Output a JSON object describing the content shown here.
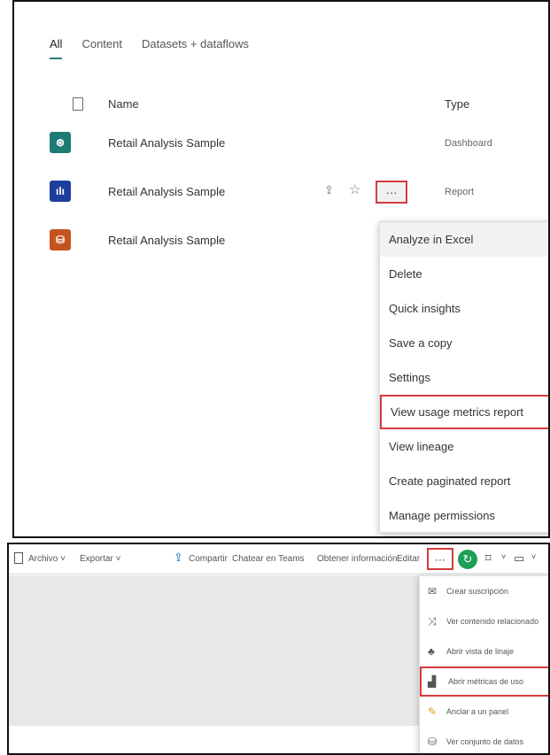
{
  "workspace": {
    "tabs": [
      {
        "label": "All",
        "active": true
      },
      {
        "label": "Content",
        "active": false
      },
      {
        "label": "Datasets + dataflows",
        "active": false
      }
    ],
    "columns": {
      "name": "Name",
      "type": "Type"
    },
    "items": [
      {
        "name": "Retail Analysis Sample",
        "type": "Dashboard",
        "icon": "dashboard-icon",
        "icon_glyph": "⊛",
        "color": "#1e7a74"
      },
      {
        "name": "Retail Analysis Sample",
        "type": "Report",
        "icon": "report-icon",
        "icon_glyph": "ılı",
        "color": "#1d3e9c"
      },
      {
        "name": "Retail Analysis Sample",
        "type": "",
        "icon": "dataset-icon",
        "icon_glyph": "⛁",
        "color": "#c6531f"
      }
    ],
    "more_label": "···",
    "context_menu": [
      "Analyze in Excel",
      "Delete",
      "Quick insights",
      "Save a copy",
      "Settings",
      "View usage metrics report",
      "View lineage",
      "Create paginated report",
      "Manage permissions"
    ]
  },
  "report_toolbar": {
    "file": "Archivo ˅",
    "export": "Exportar ˅",
    "share": "Compartir",
    "teams": "Chatear en Teams",
    "insights": "Obtener información",
    "edit": "Editar",
    "more": "···",
    "refresh_icon": "refresh-icon",
    "bookmark_icon": "bookmark-icon",
    "view_icon": "view-icon"
  },
  "report_menu": [
    {
      "label": "Crear suscripción",
      "icon": "subscribe-icon",
      "glyph": "✉"
    },
    {
      "label": "Ver contenido relacionado",
      "icon": "related-content-icon",
      "glyph": "⤨"
    },
    {
      "label": "Abrir vista de linaje",
      "icon": "lineage-icon",
      "glyph": "♣"
    },
    {
      "label": "Abrir métricas de uso",
      "icon": "usage-metrics-icon",
      "glyph": "▟"
    },
    {
      "label": "Anclar a un panel",
      "icon": "pin-icon",
      "glyph": "✎"
    },
    {
      "label": "Ver conjunto de datos",
      "icon": "dataset-icon",
      "glyph": "⛁"
    }
  ],
  "colors": {
    "highlight": "#d23b3b",
    "accent": "#2d7d78",
    "refresh": "#1f9e57"
  }
}
